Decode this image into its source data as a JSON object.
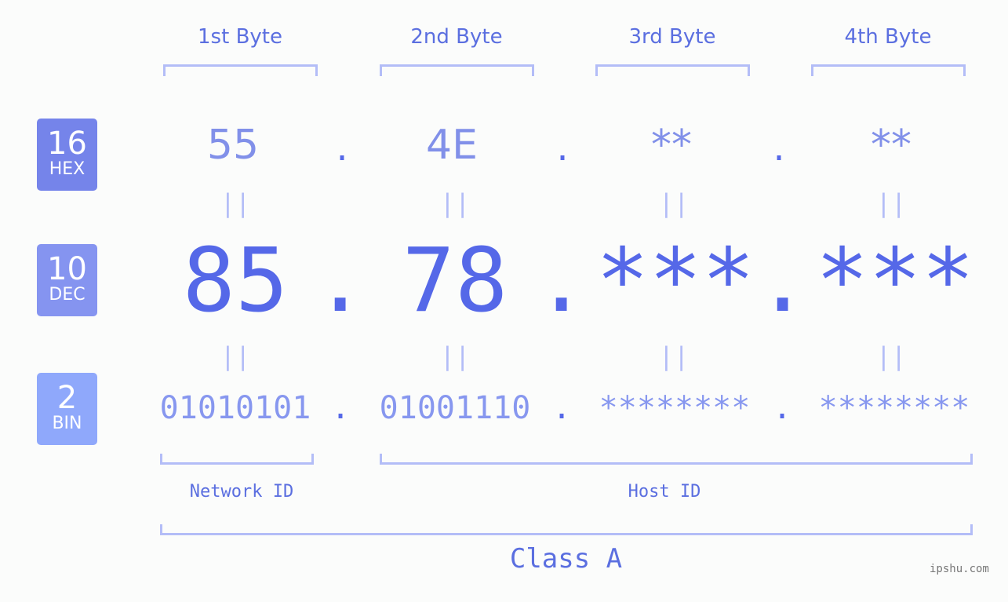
{
  "badges": [
    {
      "num": "16",
      "label": "HEX",
      "color": "#7584ea"
    },
    {
      "num": "10",
      "label": "DEC",
      "color": "#8594f0"
    },
    {
      "num": "2",
      "label": "BIN",
      "color": "#8fa8fb"
    }
  ],
  "bytes": [
    {
      "header": "1st Byte",
      "hex": "55",
      "dec": "85",
      "bin": "01010101"
    },
    {
      "header": "2nd Byte",
      "hex": "4E",
      "dec": "78",
      "bin": "01001110"
    },
    {
      "header": "3rd Byte",
      "hex": "**",
      "dec": "***",
      "bin": "********"
    },
    {
      "header": "4th Byte",
      "hex": "**",
      "dec": "***",
      "bin": "********"
    }
  ],
  "separator": ".",
  "equals": "||",
  "network_id_label": "Network ID",
  "host_id_label": "Host ID",
  "class_label": "Class A",
  "watermark": "ipshu.com"
}
